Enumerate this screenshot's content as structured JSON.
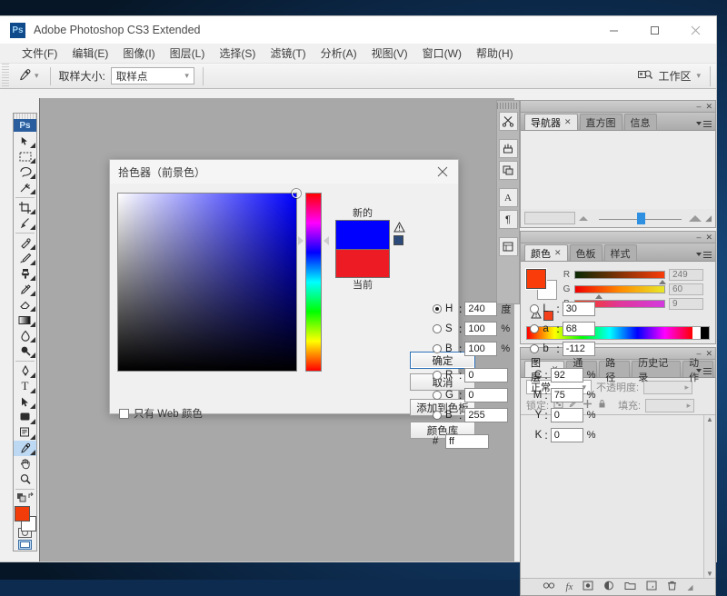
{
  "window": {
    "app_title": "Adobe Photoshop CS3 Extended",
    "logo_text": "Ps",
    "minimize": "–",
    "maximize": "□",
    "close": "✕"
  },
  "menubar": {
    "items": [
      {
        "label": "文件(F)"
      },
      {
        "label": "编辑(E)"
      },
      {
        "label": "图像(I)"
      },
      {
        "label": "图层(L)"
      },
      {
        "label": "选择(S)"
      },
      {
        "label": "滤镜(T)"
      },
      {
        "label": "分析(A)"
      },
      {
        "label": "视图(V)"
      },
      {
        "label": "窗口(W)"
      },
      {
        "label": "帮助(H)"
      }
    ]
  },
  "options_bar": {
    "tool_icon": "eyedropper-icon",
    "sample_size_label": "取样大小:",
    "sample_size_value": "取样点",
    "workspace_label": "工作区",
    "workspace_icon": "workspace-search-icon"
  },
  "toolbox": {
    "logo_text": "Ps",
    "selected_tool": "eyedropper",
    "foreground_color": "#f23c09",
    "background_color": "#ffffff",
    "tools": [
      {
        "name": "move-tool",
        "glyph": "✥"
      },
      {
        "name": "marquee-tool",
        "glyph": "▭"
      },
      {
        "name": "lasso-tool",
        "glyph": "♪"
      },
      {
        "name": "magic-wand-tool",
        "glyph": "✳"
      },
      {
        "name": "crop-tool",
        "glyph": "⌗"
      },
      {
        "name": "slice-tool",
        "glyph": "✂"
      },
      {
        "name": "healing-brush-tool",
        "glyph": "✎"
      },
      {
        "name": "brush-tool",
        "glyph": "🖌"
      },
      {
        "name": "clone-stamp-tool",
        "glyph": "⚒"
      },
      {
        "name": "history-brush-tool",
        "glyph": "✒"
      },
      {
        "name": "eraser-tool",
        "glyph": "◻"
      },
      {
        "name": "gradient-tool",
        "glyph": "▬"
      },
      {
        "name": "blur-tool",
        "glyph": "💧"
      },
      {
        "name": "dodge-tool",
        "glyph": "●"
      },
      {
        "name": "pen-tool",
        "glyph": "✑"
      },
      {
        "name": "type-tool",
        "glyph": "T"
      },
      {
        "name": "path-selection-tool",
        "glyph": "➤"
      },
      {
        "name": "shape-tool",
        "glyph": "▢"
      },
      {
        "name": "notes-tool",
        "glyph": "🗒"
      },
      {
        "name": "eyedropper-tool",
        "glyph": "✐"
      },
      {
        "name": "hand-tool",
        "glyph": "✋"
      },
      {
        "name": "zoom-tool",
        "glyph": "🔍"
      }
    ],
    "quick_mask_icon": "quick-mask-icon",
    "screen_mode_icon": "screen-mode-icon"
  },
  "dock_strip": {
    "buttons": [
      {
        "name": "tool-presets-icon",
        "glyph": "✂"
      },
      {
        "name": "brushes-icon",
        "glyph": "🖌"
      },
      {
        "name": "clone-source-icon",
        "glyph": "⎘"
      },
      {
        "name": "character-icon",
        "glyph": "A"
      },
      {
        "name": "paragraph-icon",
        "glyph": "¶"
      },
      {
        "name": "layer-comps-icon",
        "glyph": "▤"
      }
    ]
  },
  "panels": {
    "navigator": {
      "tabs": [
        {
          "label": "导航器",
          "active": true,
          "closable": true
        },
        {
          "label": "直方图",
          "active": false,
          "closable": false
        },
        {
          "label": "信息",
          "active": false,
          "closable": false
        }
      ],
      "zoom_value": "",
      "minimize": "–",
      "close": "✕"
    },
    "color": {
      "tabs": [
        {
          "label": "颜色",
          "active": true,
          "closable": true
        },
        {
          "label": "色板",
          "active": false,
          "closable": false
        },
        {
          "label": "样式",
          "active": false,
          "closable": false
        }
      ],
      "foreground_color": "#f93c09",
      "background_color": "#ffffff",
      "out_of_gamut_icon": "warning-icon",
      "out_of_gamut_color": "#f4401a",
      "channels": [
        {
          "label": "R",
          "value": "249",
          "pos": 97
        },
        {
          "label": "G",
          "value": "60",
          "pos": 24
        },
        {
          "label": "B",
          "value": "9",
          "pos": 4
        }
      ],
      "minimize": "–",
      "close": "✕"
    },
    "layers": {
      "tabs": [
        {
          "label": "图层",
          "active": true,
          "closable": true
        },
        {
          "label": "通道",
          "active": false,
          "closable": false
        },
        {
          "label": "路径",
          "active": false,
          "closable": false
        },
        {
          "label": "历史记录",
          "active": false,
          "closable": false
        },
        {
          "label": "动作",
          "active": false,
          "closable": false
        }
      ],
      "blend_mode": "正常",
      "opacity_label": "不透明度:",
      "opacity_value": "",
      "lock_label": "锁定:",
      "fill_label": "填充:",
      "fill_value": "",
      "lock_icons": [
        {
          "name": "lock-transparency-icon",
          "glyph": "▣"
        },
        {
          "name": "lock-image-icon",
          "glyph": "✎"
        },
        {
          "name": "lock-position-icon",
          "glyph": "✛"
        },
        {
          "name": "lock-all-icon",
          "glyph": "🔒"
        }
      ],
      "footer_icons": [
        {
          "name": "link-layers-icon",
          "glyph": "∞"
        },
        {
          "name": "layer-style-icon",
          "glyph": "fx"
        },
        {
          "name": "layer-mask-icon",
          "glyph": "▣"
        },
        {
          "name": "adjustment-layer-icon",
          "glyph": "◑"
        },
        {
          "name": "new-group-icon",
          "glyph": "▭"
        },
        {
          "name": "new-layer-icon",
          "glyph": "▣"
        },
        {
          "name": "delete-layer-icon",
          "glyph": "🗑"
        }
      ],
      "minimize": "–",
      "close": "✕"
    }
  },
  "color_picker": {
    "title": "拾色器（前景色）",
    "close": "✕",
    "new_label": "新的",
    "current_label": "当前",
    "new_color": "#0000ff",
    "current_color": "#ed1c24",
    "out_of_gamut_warning_icon": "warning-triangle-icon",
    "out_of_gamut_chip": "#2b4a7a",
    "buttons": [
      {
        "name": "ok-button",
        "label": "确定",
        "primary": true
      },
      {
        "name": "cancel-button",
        "label": "取消",
        "primary": false
      },
      {
        "name": "add-to-swatches-button",
        "label": "添加到色板",
        "primary": false
      },
      {
        "name": "color-libraries-button",
        "label": "颜色库",
        "primary": false
      }
    ],
    "web_only_label": "只有 Web 颜色",
    "web_only_checked": false,
    "hsb": [
      {
        "name": "H",
        "value": "240",
        "unit": "度",
        "selected": true
      },
      {
        "name": "S",
        "value": "100",
        "unit": "%",
        "selected": false
      },
      {
        "name": "B",
        "value": "100",
        "unit": "%",
        "selected": false
      }
    ],
    "lab": [
      {
        "name": "L",
        "value": "30",
        "unit": "",
        "selected": false
      },
      {
        "name": "a",
        "value": "68",
        "unit": "",
        "selected": false
      },
      {
        "name": "b",
        "value": "-112",
        "unit": "",
        "selected": false
      }
    ],
    "rgb": [
      {
        "name": "R",
        "value": "0",
        "unit": "",
        "selected": false
      },
      {
        "name": "G",
        "value": "0",
        "unit": "",
        "selected": false
      },
      {
        "name": "B",
        "value": "255",
        "unit": "",
        "selected": false
      }
    ],
    "cmyk": [
      {
        "name": "C",
        "value": "92",
        "unit": "%"
      },
      {
        "name": "M",
        "value": "75",
        "unit": "%"
      },
      {
        "name": "Y",
        "value": "0",
        "unit": "%"
      },
      {
        "name": "K",
        "value": "0",
        "unit": "%"
      }
    ],
    "hex_label": "#",
    "hex_value": "ff"
  }
}
